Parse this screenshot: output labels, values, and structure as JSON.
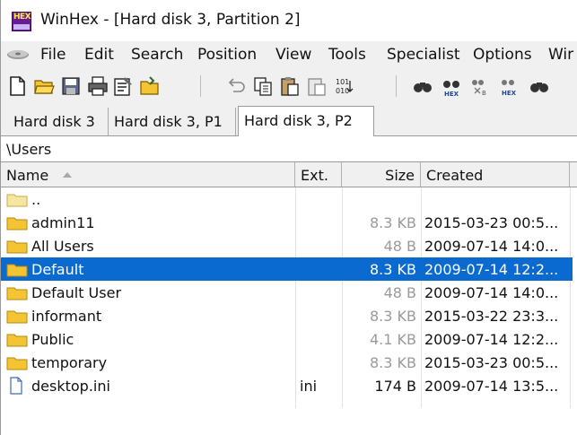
{
  "window": {
    "title": "WinHex - [Hard disk 3, Partition 2]"
  },
  "menu": {
    "items": [
      {
        "label": "File"
      },
      {
        "label": "Edit"
      },
      {
        "label": "Search"
      },
      {
        "label": "Position"
      },
      {
        "label": "View"
      },
      {
        "label": "Tools"
      },
      {
        "label": "Specialist"
      },
      {
        "label": "Options"
      },
      {
        "label": "Wir"
      }
    ]
  },
  "toolbar": {
    "icons": [
      "new-icon",
      "open-icon",
      "save-icon",
      "print-icon",
      "properties-icon",
      "open-folder-icon",
      "undo-icon",
      "copy-icon",
      "paste-icon",
      "paste-special-icon",
      "binary-icon",
      "find-text-icon",
      "find-hex-icon",
      "replace-text-icon",
      "replace-hex-icon",
      "find-again-icon"
    ],
    "binary_label": "101\n010"
  },
  "tabs": [
    {
      "label": "Hard disk 3"
    },
    {
      "label": "Hard disk 3, P1"
    },
    {
      "label": "Hard disk 3, P2",
      "active": true
    }
  ],
  "path": "\\Users",
  "columns": {
    "name": "Name",
    "ext": "Ext.",
    "size": "Size",
    "created": "Created"
  },
  "rows": [
    {
      "name": "..",
      "ext": "",
      "size": "",
      "created": "",
      "type": "parent"
    },
    {
      "name": "admin11",
      "ext": "",
      "size": "8.3 KB",
      "created": "2015-03-23  00:5...",
      "type": "folder"
    },
    {
      "name": "All Users",
      "ext": "",
      "size": "48 B",
      "created": "2009-07-14  14:0...",
      "type": "folder"
    },
    {
      "name": "Default",
      "ext": "",
      "size": "8.3 KB",
      "created": "2009-07-14  12:2...",
      "type": "folder",
      "selected": true
    },
    {
      "name": "Default User",
      "ext": "",
      "size": "48 B",
      "created": "2009-07-14  14:0...",
      "type": "folder"
    },
    {
      "name": "informant",
      "ext": "",
      "size": "8.3 KB",
      "created": "2015-03-22  23:3...",
      "type": "folder"
    },
    {
      "name": "Public",
      "ext": "",
      "size": "4.1 KB",
      "created": "2009-07-14  12:2...",
      "type": "folder"
    },
    {
      "name": "temporary",
      "ext": "",
      "size": "8.3 KB",
      "created": "2015-03-23  00:5...",
      "type": "folder"
    },
    {
      "name": "desktop.ini",
      "ext": "ini",
      "size": "174 B",
      "created": "2009-07-14  13:5...",
      "type": "file"
    }
  ],
  "colors": {
    "selection": "#0a6ad0",
    "folder": "#f4c433",
    "muted_size": "#9a9a9a"
  }
}
